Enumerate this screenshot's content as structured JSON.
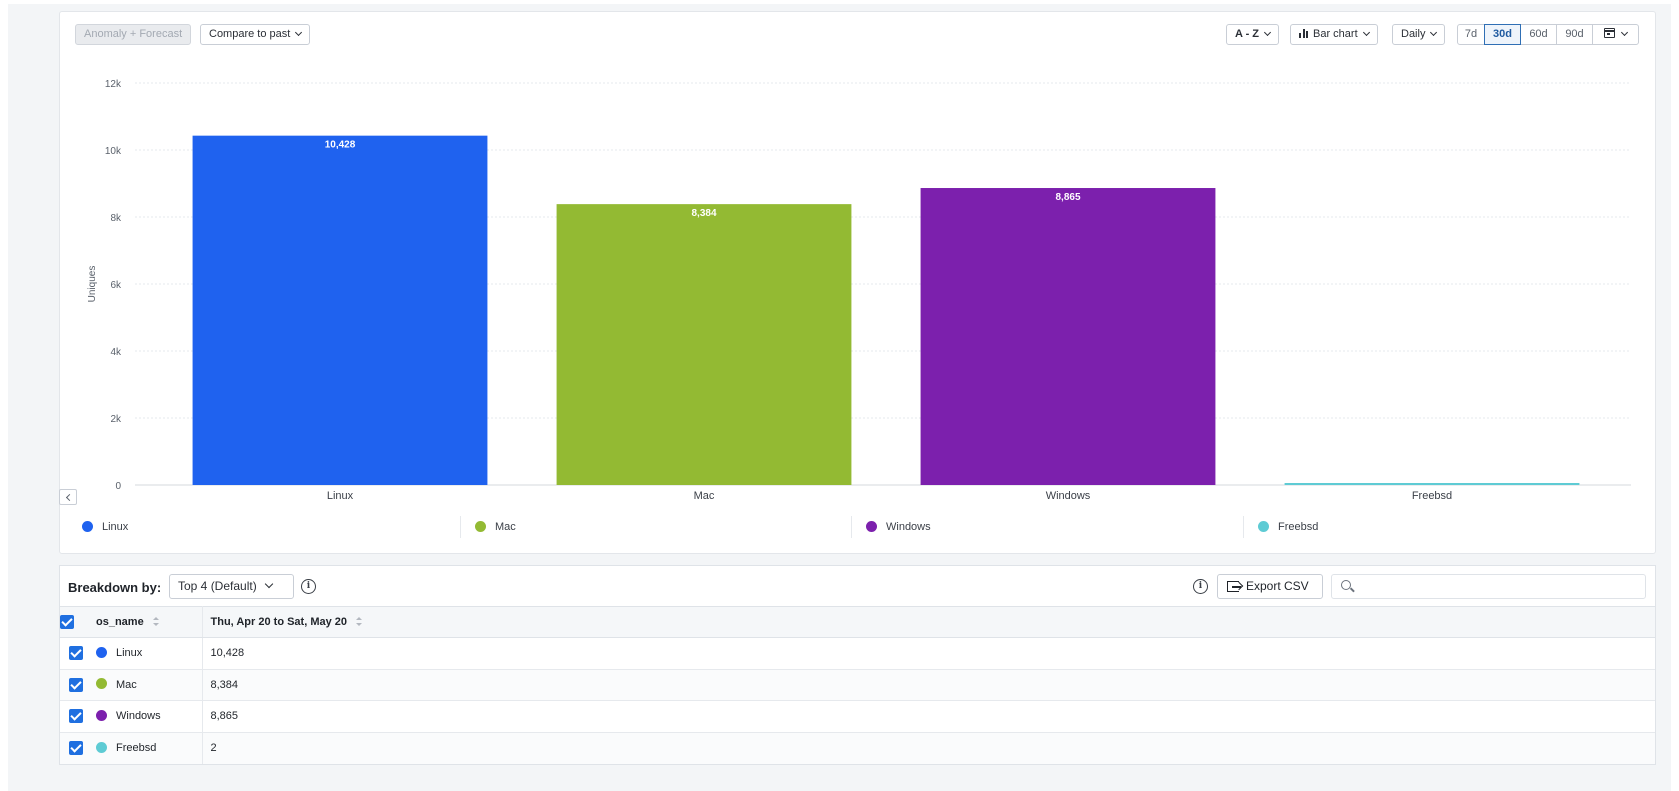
{
  "toolbar": {
    "anomaly_label": "Anomaly + Forecast",
    "compare_label": "Compare to past",
    "sort_label": "A - Z",
    "chart_type_label": "Bar chart",
    "interval_label": "Daily",
    "ranges": [
      "7d",
      "30d",
      "60d",
      "90d"
    ],
    "active_range": "30d"
  },
  "chart_data": {
    "type": "bar",
    "categories": [
      "Linux",
      "Mac",
      "Windows",
      "Freebsd"
    ],
    "values": [
      10428,
      8384,
      8865,
      2
    ],
    "data_labels": [
      "10,428",
      "8,384",
      "8,865",
      ""
    ],
    "colors": [
      "#1f62ef",
      "#93ba33",
      "#7c20ad",
      "#5ecbd4"
    ],
    "xlabel": "",
    "ylabel": "Uniques",
    "ylim": [
      0,
      12000
    ],
    "yticks": [
      0,
      2000,
      4000,
      6000,
      8000,
      10000,
      12000
    ],
    "ytick_labels": [
      "0",
      "2k",
      "4k",
      "6k",
      "8k",
      "10k",
      "12k"
    ],
    "grid": true,
    "legend": "bottom"
  },
  "legend": [
    {
      "label": "Linux",
      "color": "#1f62ef"
    },
    {
      "label": "Mac",
      "color": "#93ba33"
    },
    {
      "label": "Windows",
      "color": "#7c20ad"
    },
    {
      "label": "Freebsd",
      "color": "#5ecbd4"
    }
  ],
  "breakdown": {
    "label": "Breakdown by:",
    "select_value": "Top 4 (Default)",
    "info_glyph": "i",
    "export_label": "Export CSV",
    "search_placeholder": "",
    "columns": [
      "os_name",
      "Thu, Apr 20 to Sat, May 20"
    ],
    "rows": [
      {
        "name": "Linux",
        "value": "10,428",
        "color": "#1f62ef"
      },
      {
        "name": "Mac",
        "value": "8,384",
        "color": "#93ba33"
      },
      {
        "name": "Windows",
        "value": "8,865",
        "color": "#7c20ad"
      },
      {
        "name": "Freebsd",
        "value": "2",
        "color": "#5ecbd4"
      }
    ]
  }
}
